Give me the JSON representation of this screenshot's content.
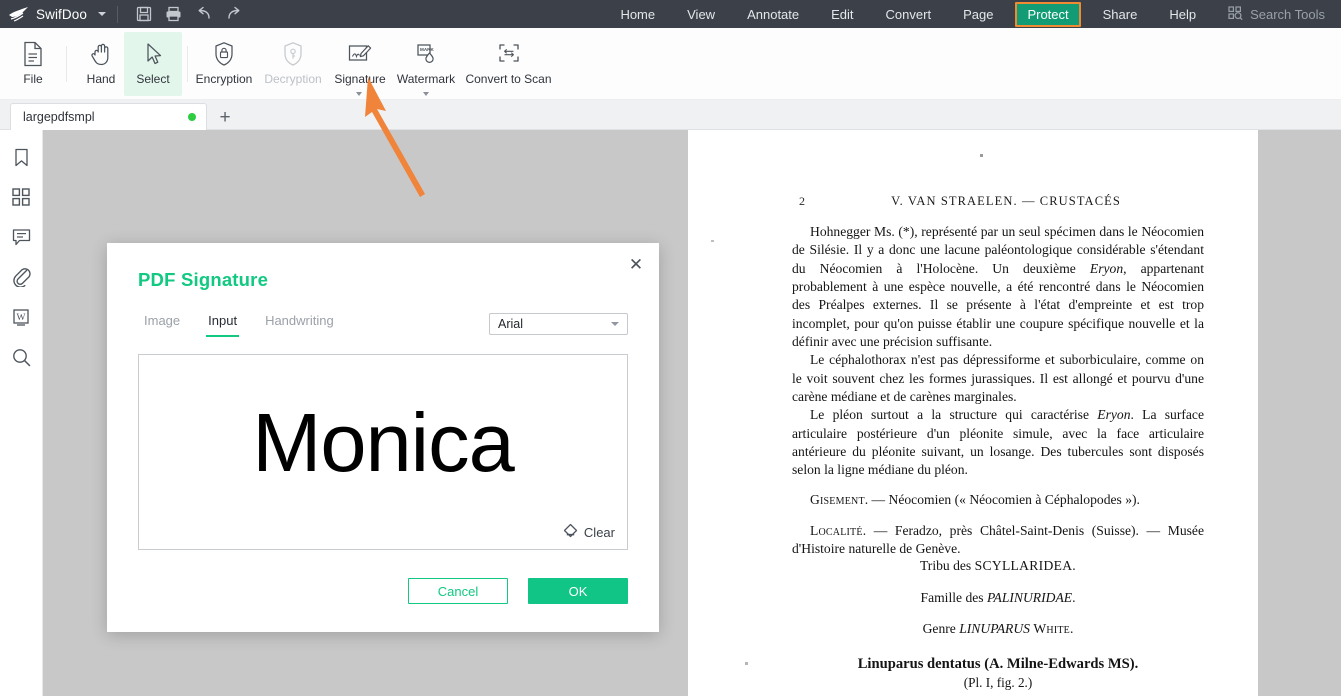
{
  "app": {
    "brand": "SwifDoo",
    "logo_icon": "bird-logo-icon",
    "brand_caret_icon": "chevron-down-icon"
  },
  "titlebar": {
    "quick_actions": [
      {
        "name": "save-button",
        "icon": "save-floppy-icon"
      },
      {
        "name": "print-button",
        "icon": "printer-icon"
      },
      {
        "name": "undo-button",
        "icon": "undo-arrow-icon"
      },
      {
        "name": "redo-button",
        "icon": "redo-arrow-icon"
      }
    ],
    "menu": [
      {
        "label": "Home",
        "active": false
      },
      {
        "label": "View",
        "active": false
      },
      {
        "label": "Annotate",
        "active": false
      },
      {
        "label": "Edit",
        "active": false
      },
      {
        "label": "Convert",
        "active": false
      },
      {
        "label": "Page",
        "active": false
      },
      {
        "label": "Protect",
        "active": true
      },
      {
        "label": "Share",
        "active": false
      },
      {
        "label": "Help",
        "active": false
      }
    ],
    "search_tools": {
      "label": "Search Tools",
      "icon": "search-tools-icon"
    }
  },
  "ribbon": {
    "items": [
      {
        "label": "File",
        "icon": "file-page-icon",
        "state": "normal",
        "caret": false
      },
      {
        "label": "Hand",
        "icon": "hand-icon",
        "state": "normal",
        "caret": false
      },
      {
        "label": "Select",
        "icon": "cursor-arrow-icon",
        "state": "selected",
        "caret": false
      },
      {
        "label": "Encryption",
        "icon": "shield-lock-icon",
        "state": "normal",
        "caret": false
      },
      {
        "label": "Decryption",
        "icon": "shield-key-icon",
        "state": "disabled",
        "caret": false
      },
      {
        "label": "Signature",
        "icon": "signature-pen-icon",
        "state": "normal",
        "caret": true
      },
      {
        "label": "Watermark",
        "icon": "watermark-mark-icon",
        "state": "normal",
        "caret": true
      },
      {
        "label": "Convert to Scan",
        "icon": "convert-to-scan-icon",
        "state": "normal",
        "caret": false
      }
    ]
  },
  "tabstrip": {
    "document_tab": {
      "name": "largepdfsmpl",
      "modified_dot": true
    },
    "new_tab_label": "+"
  },
  "sidebar": {
    "items": [
      {
        "name": "bookmarks",
        "icon": "bookmark-icon"
      },
      {
        "name": "thumbnails",
        "icon": "grid-thumbnails-icon"
      },
      {
        "name": "comments",
        "icon": "comment-bubble-icon"
      },
      {
        "name": "attachments",
        "icon": "paperclip-icon"
      },
      {
        "name": "word-export",
        "icon": "word-w-icon"
      },
      {
        "name": "search",
        "icon": "magnifier-icon"
      }
    ]
  },
  "annotation": {
    "arrow_icon": "orange-arrow-icon",
    "arrow_color": "#f0843b",
    "points_to": "Signature"
  },
  "dialog": {
    "title": "PDF Signature",
    "close_icon": "close-x-icon",
    "tabs": [
      {
        "label": "Image",
        "active": false
      },
      {
        "label": "Input",
        "active": true
      },
      {
        "label": "Handwriting",
        "active": false
      }
    ],
    "font_select": {
      "value": "Arial",
      "caret_icon": "chevron-down-icon"
    },
    "signature_value": "Monica",
    "clear": {
      "label": "Clear",
      "icon": "eraser-icon"
    },
    "buttons": {
      "cancel": "Cancel",
      "ok": "OK"
    }
  },
  "document": {
    "page_number": "2",
    "running_head": "V. VAN STRAELEN. — CRUSTACÉS",
    "paragraphs": [
      "Hohnegger Ms. (*), représenté par un seul spécimen dans le Néocomien de Silésie. Il y a donc une lacune paléontologique considérable s'étendant du Néocomien à l'Holocène. Un deuxième Eryon, appartenant probablement à une espèce nouvelle, a été rencontré dans le Néocomien des Préalpes externes. Il se présente à l'état d'empreinte et est trop incomplet, pour qu'on puisse établir une coupure spécifique nouvelle et la définir avec une précision suffisante.",
      "Le céphalothorax n'est pas dépressiforme et suborbiculaire, comme on le voit souvent chez les formes jurassiques. Il est allongé et pourvu d'une carène médiane et de carènes marginales.",
      "Le pléon surtout a la structure qui caractérise Eryon. La surface articulaire postérieure d'un pléonite simule, avec la face articulaire antérieure du pléonite suivant, un losange. Des tubercules sont disposés selon la ligne médiane du pléon."
    ],
    "gisement": "GISEMENT. — Néocomien (« Néocomien à Céphalopodes »).",
    "localite": "LOCALITÉ. — Feradzo, près Châtel-Saint-Denis (Suisse). — Musée d'Histoire naturelle de Genève.",
    "tribu": "Tribu des SCYLLARIDEA.",
    "famille": "Famille des PALINURIDAE.",
    "genre": "Genre LINUPARUS WHITE.",
    "species": "Linuparus dentatus (A. Milne-Edwards MS).",
    "plate_ref": "(Pl. I, fig. 2.)"
  },
  "colors": {
    "titlebar_bg": "#3b4049",
    "accent_green": "#11c981",
    "active_tab_bg": "#129c76",
    "active_tab_border": "#f08a33",
    "ribbon_selected_bg": "#e3f6ec",
    "viewer_bg": "#c8c8c8",
    "arrow_orange": "#f0843b"
  }
}
